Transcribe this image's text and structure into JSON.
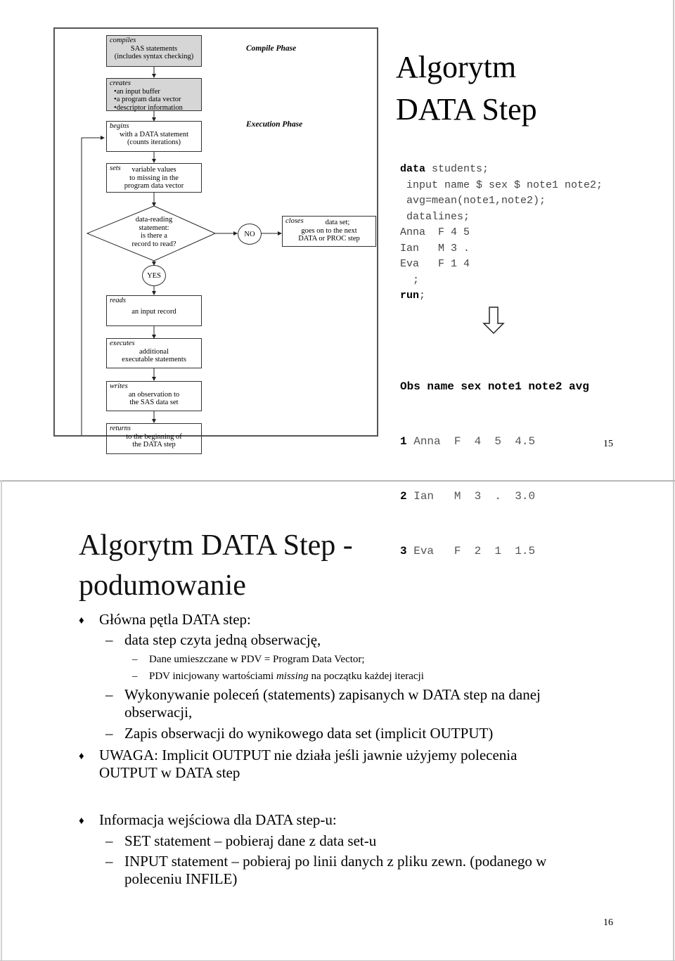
{
  "slide15": {
    "title_line1": "Algorytm",
    "title_line2": "DATA Step",
    "page_number": "15",
    "diagram": {
      "compile_phase_label": "Compile Phase",
      "execution_phase_label": "Execution Phase",
      "compiles": {
        "verb": "compiles",
        "line1": "SAS statements",
        "line2": "(includes syntax checking)"
      },
      "creates": {
        "verb": "creates",
        "items": [
          "an input buffer",
          "a program data vector",
          "descriptor information"
        ]
      },
      "begins": {
        "verb": "begins",
        "line1": "with a DATA statement",
        "line2": "(counts iterations)"
      },
      "sets": {
        "verb": "sets",
        "line1": "variable values",
        "line2": "to missing in the",
        "line3": "program data vector"
      },
      "decision": {
        "line1": "data-reading",
        "line2": "statement:",
        "line3": "is there a",
        "line4": "record to read?"
      },
      "no_label": "NO",
      "yes_label": "YES",
      "closes": {
        "verb": "closes",
        "line1": "data set;",
        "line2": "goes on to the next",
        "line3": "DATA or PROC step"
      },
      "reads": {
        "verb": "reads",
        "line1": "an input record"
      },
      "executes": {
        "verb": "executes",
        "line1": "additional",
        "line2": "executable statements"
      },
      "writes": {
        "verb": "writes",
        "line1": "an observation to",
        "line2": "the SAS data set"
      },
      "returns": {
        "verb": "returns",
        "line1": "to the beginning of",
        "line2": "the DATA step"
      }
    },
    "code": {
      "line1_kw": "data",
      "line1_rest": " students;",
      "line2": " input name $ sex $ note1 note2;",
      "line3": " avg=mean(note1,note2);",
      "line4": " datalines;",
      "line5": "Anna  F 4 5",
      "line6": "Ian   M 3 .",
      "line7": "Eva   F 1 4",
      "line8": "  ;",
      "line9_kw": "run",
      "line9_rest": ";"
    },
    "output_table": {
      "header": "Obs name sex note1 note2 avg",
      "rows": [
        {
          "obs": "1",
          "rest": " Anna  F  4  5  4.5"
        },
        {
          "obs": "2",
          "rest": " Ian   M  3  .  3.0"
        },
        {
          "obs": "3",
          "rest": " Eva   F  2  1  1.5"
        }
      ]
    }
  },
  "slide16": {
    "title_line1": "Algorytm DATA Step -",
    "title_line2": "podumowanie",
    "page_number": "16",
    "bullets": {
      "b1": "Główna pętla DATA step:",
      "b1_1": "data step czyta jedną obserwację,",
      "b1_1_1": "Dane umieszczane w PDV = Program Data Vector;",
      "b1_1_2_pre": "PDV inicjowany wartościami ",
      "b1_1_2_em": "missing",
      "b1_1_2_post": " na początku każdej iteracji",
      "b1_2_l1": "Wykonywanie poleceń (statements) zapisanych w DATA step na danej",
      "b1_2_l2": "obserwacji,",
      "b1_3": "Zapis obserwacji do wynikowego data set (implicit OUTPUT)",
      "b2_l1": "UWAGA: Implicit OUTPUT nie działa jeśli jawnie użyjemy polecenia",
      "b2_l2": "OUTPUT w DATA step",
      "b3": "Informacja wejściowa dla DATA step-u:",
      "b3_1": "SET statement – pobieraj dane z data set-u",
      "b3_2_l1": "INPUT statement – pobieraj po linii danych z pliku zewn. (podanego w",
      "b3_2_l2": "poleceniu INFILE)"
    }
  }
}
